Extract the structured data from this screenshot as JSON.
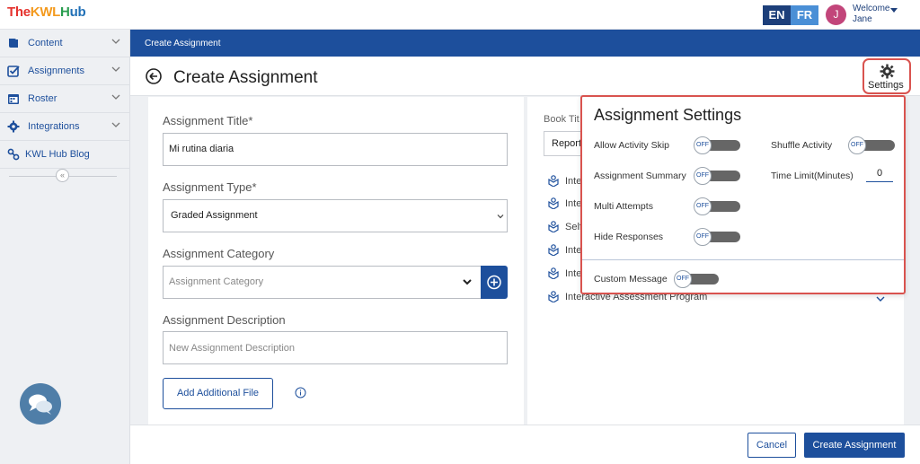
{
  "header": {
    "logo_parts": [
      "The",
      "KWL",
      "H",
      "ub"
    ],
    "lang_en": "EN",
    "lang_fr": "FR",
    "avatar_initial": "J",
    "welcome": "Welcome",
    "user_name": "Jane"
  },
  "sidebar": {
    "items": [
      {
        "label": "Content",
        "icon": "book-icon"
      },
      {
        "label": "Assignments",
        "icon": "checkbox-icon"
      },
      {
        "label": "Roster",
        "icon": "calendar-icon"
      },
      {
        "label": "Integrations",
        "icon": "gear-icon"
      },
      {
        "label": "KWL Hub Blog",
        "icon": "link-icon"
      }
    ],
    "collapse_glyph": "«"
  },
  "breadcrumb": "Create Assignment",
  "page_title": "Create Assignment",
  "settings_label": "Settings",
  "form": {
    "title_label": "Assignment Title*",
    "title_value": "Mi rutina diaria",
    "type_label": "Assignment Type*",
    "type_value": "Graded Assignment",
    "category_label": "Assignment Category",
    "category_placeholder": "Assignment Category",
    "description_label": "Assignment Description",
    "description_placeholder": "New Assignment Description",
    "add_file_label": "Add Additional File"
  },
  "book": {
    "label": "Book Tit",
    "select_value": "Reporta",
    "programs": [
      "Inte",
      "Inte",
      "Self",
      "Inte",
      "Inte",
      "Interactive Assessment Program"
    ]
  },
  "settings_popover": {
    "title": "Assignment Settings",
    "options": [
      {
        "label": "Allow Activity Skip",
        "state": "OFF"
      },
      {
        "label": "Assignment Summary",
        "state": "OFF"
      },
      {
        "label": "Multi Attempts",
        "state": "OFF"
      },
      {
        "label": "Hide Responses",
        "state": "OFF"
      },
      {
        "label": "Shuffle Activity",
        "state": "OFF"
      }
    ],
    "time_limit_label": "Time Limit(Minutes)",
    "time_limit_value": "0",
    "custom_message_label": "Custom Message",
    "custom_message_state": "OFF"
  },
  "footer": {
    "cancel_label": "Cancel",
    "create_label": "Create Assignment"
  },
  "colors": {
    "primary": "#1d4f9c",
    "highlight_border": "#d9534f",
    "toggle_track": "#666666"
  }
}
